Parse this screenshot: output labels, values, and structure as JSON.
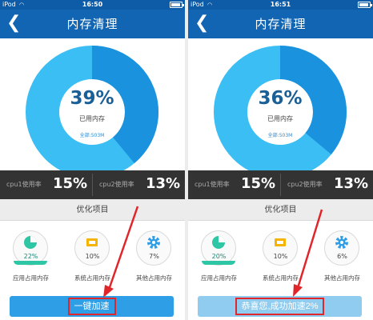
{
  "colors": {
    "status_bar": "#0e5ba8",
    "nav_bar": "#1165b3",
    "donut_used": "#1a92de",
    "donut_free": "#3bbef3",
    "cpu_bar": "#333333",
    "accent_text": "#1a5f96",
    "button": "#2e9ee6",
    "button_done": "#8fccef",
    "highlight": "#e0262b",
    "app_wave": "#2fc6a5"
  },
  "panels": [
    {
      "status": {
        "carrier": "iPod",
        "time": "16:50"
      },
      "nav": {
        "back_icon": "chevron-left-icon",
        "title": "内存清理"
      },
      "memory": {
        "percent": "39%",
        "percent_value": 39,
        "used_label": "已用内存",
        "total_label": "全部:503M"
      },
      "cpu": [
        {
          "label": "cpu1使用率",
          "value": "15%"
        },
        {
          "label": "cpu2使用率",
          "value": "13%"
        }
      ],
      "section_title": "优化项目",
      "items": [
        {
          "icon": "pie-chart-icon",
          "percent": "22%",
          "label": "应用占用内存"
        },
        {
          "icon": "chip-icon",
          "percent": "10%",
          "label": "系统占用内存"
        },
        {
          "icon": "gear-icon",
          "percent": "7%",
          "label": "其他占用内存"
        }
      ],
      "button": {
        "label": "一键加速"
      }
    },
    {
      "status": {
        "carrier": "iPod",
        "time": "16:51"
      },
      "nav": {
        "back_icon": "chevron-left-icon",
        "title": "内存清理"
      },
      "memory": {
        "percent": "36%",
        "percent_value": 36,
        "used_label": "已用内存",
        "total_label": "全部:503M"
      },
      "cpu": [
        {
          "label": "cpu1使用率",
          "value": "15%"
        },
        {
          "label": "cpu2使用率",
          "value": "13%"
        }
      ],
      "section_title": "优化项目",
      "items": [
        {
          "icon": "pie-chart-icon",
          "percent": "20%",
          "label": "应用占用内存"
        },
        {
          "icon": "chip-icon",
          "percent": "10%",
          "label": "系统占用内存"
        },
        {
          "icon": "gear-icon",
          "percent": "6%",
          "label": "其他占用内存"
        }
      ],
      "button": {
        "label": "恭喜您,成功加速2%"
      }
    }
  ]
}
